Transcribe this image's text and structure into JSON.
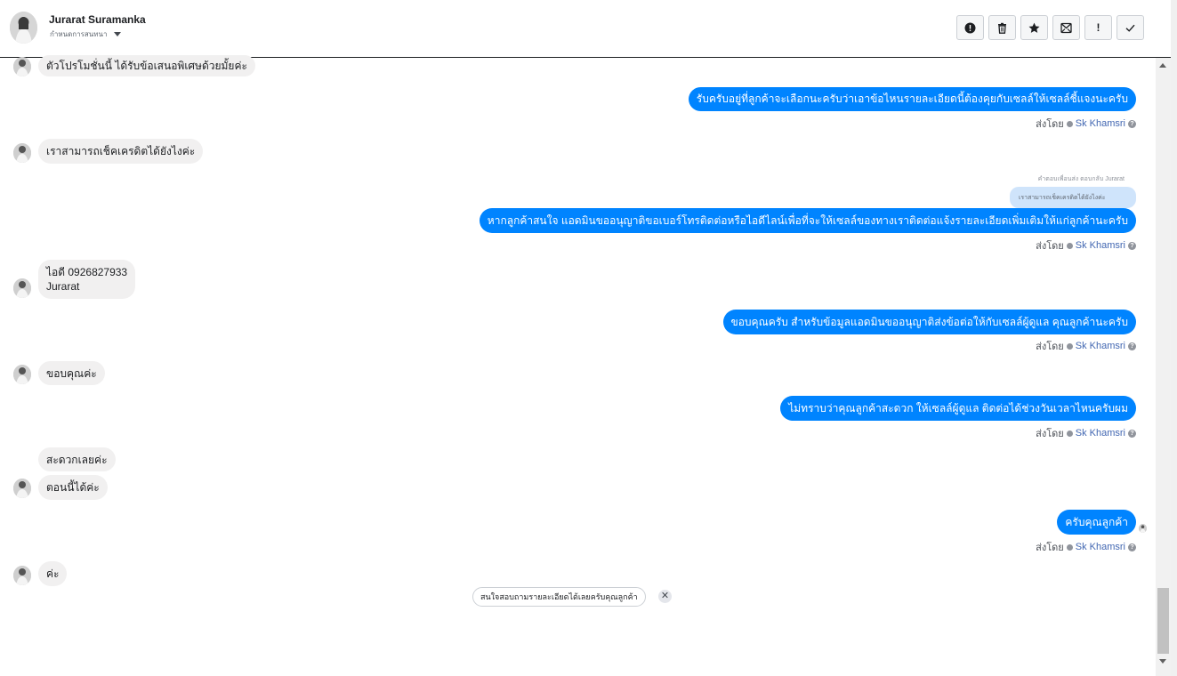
{
  "header": {
    "contact_name": "Jurarat Suramanka",
    "sub_label": "กำหนดการสนทนา",
    "toolbar": [
      {
        "icon": "alert-circle-icon"
      },
      {
        "icon": "trash-icon"
      },
      {
        "icon": "star-icon"
      },
      {
        "icon": "inbox-icon"
      },
      {
        "icon": "exclamation-icon",
        "text": "!"
      },
      {
        "icon": "check-icon"
      }
    ]
  },
  "messages": [
    {
      "dir": "in",
      "text": "ตัวโปรโมชั่นนี้ ได้รับข้อเสนอพิเศษด้วยมั้ยค่ะ"
    },
    {
      "dir": "out",
      "text": "รับครับอยู่ที่ลูกค้าจะเลือกนะครับว่าเอาข้อไหนรายละเอียดนี้ต้องคุยกับเซลล์ให้เซลล์ชี้แจงนะครับ"
    },
    {
      "dir": "in",
      "text": "เราสามารถเช็คเครดิตได้ยังไงค่ะ"
    },
    {
      "dir": "out",
      "text": "หากลูกค้าสนใจ แอดมินขออนุญาติขอเบอร์โทรติดต่อหรือไอดีไลน์เพื่อที่จะให้เซลล์ของทางเราติดต่อแจ้งรายละเอียดเพิ่มเติมให้แก่ลูกค้านะครับ"
    },
    {
      "dir": "in",
      "line1": "ไอดี 0926827933",
      "line2": "Jurarat"
    },
    {
      "dir": "out",
      "text": "ขอบคุณครับ สำหรับข้อมูลแอดมินขออนุญาติส่งข้อต่อให้กับเซลล์ผู้ดูแล คุณลูกค้านะครับ"
    },
    {
      "dir": "in",
      "text": "ขอบคุณค่ะ"
    },
    {
      "dir": "out",
      "text": "ไม่ทราบว่าคุณลูกค้าสะดวก ให้เซลล์ผู้ดูแล ติดต่อได้ช่วงวันเวลาไหนครับผม"
    },
    {
      "dir": "in",
      "text": "สะดวกเลยค่ะ"
    },
    {
      "dir": "in",
      "text": "ตอนนี้ได้ค่ะ"
    },
    {
      "dir": "out",
      "text": "ครับคุณลูกค้า"
    },
    {
      "dir": "in",
      "text": "ค่ะ"
    }
  ],
  "reply": {
    "note": "คำตอบเพื่อนส่ง ตอบกลับ Jurarat",
    "quoted": "เราสามารถเช็คเครดิตได้ยังไงค่ะ"
  },
  "sent_by": {
    "prefix": "ส่งโดย",
    "name": "Sk Khamsri",
    "help": "?"
  },
  "quick_reply": {
    "text": "สนใจสอบถามรายละเอียดได้เลยครับคุณลูกค้า",
    "close": "✕"
  },
  "colors": {
    "outgoing_bubble": "#0084ff",
    "incoming_bubble": "#f1f0f0",
    "sender_name": "#4267b2"
  }
}
